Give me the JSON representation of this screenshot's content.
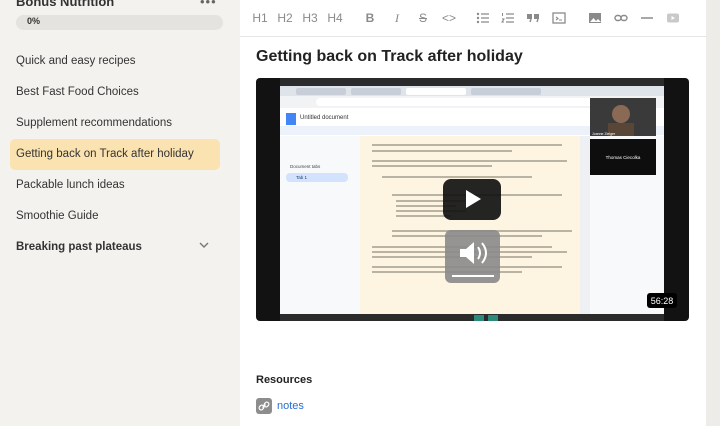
{
  "sidebar": {
    "course_title": "Bonus Nutrition",
    "more_label": "•••",
    "progress_label": "0%",
    "progress_value": 0,
    "items": [
      {
        "label": "Quick and easy recipes"
      },
      {
        "label": "Best Fast Food Choices"
      },
      {
        "label": "Supplement recommendations"
      },
      {
        "label": "Getting back on Track after holiday",
        "active": true
      },
      {
        "label": "Packable lunch ideas"
      },
      {
        "label": "Smoothie Guide"
      },
      {
        "label": "Breaking past plateaus",
        "bold": true
      }
    ]
  },
  "toolbar": {
    "h1": "H1",
    "h2": "H2",
    "h3": "H3",
    "h4": "H4",
    "bold": "B",
    "italic": "I",
    "strike": "S",
    "code": "<>",
    "icons": [
      "heading-1-icon",
      "heading-2-icon",
      "heading-3-icon",
      "heading-4-icon",
      "bold-icon",
      "italic-icon",
      "strikethrough-icon",
      "code-icon",
      "bulleted-list-icon",
      "numbered-list-icon",
      "quote-icon",
      "code-block-icon",
      "image-icon",
      "link-icon",
      "horizontal-rule-icon",
      "video-icon"
    ]
  },
  "main": {
    "title": "Getting back on Track after holiday",
    "video": {
      "duration": "56:28",
      "presenter_1": "Joanne Zielger",
      "presenter_2": "Thomas Ciecolka",
      "doc_title": "Untitled document",
      "doc_tabs_label": "Document tabs",
      "doc_tab": "Tab 1"
    },
    "resources_heading": "Resources",
    "resource_link": "notes"
  },
  "colors": {
    "sidebar_bg": "#f4f2ef",
    "active_item": "#fbe3b1",
    "link": "#2a6fcf",
    "video_bg": "#121212"
  }
}
